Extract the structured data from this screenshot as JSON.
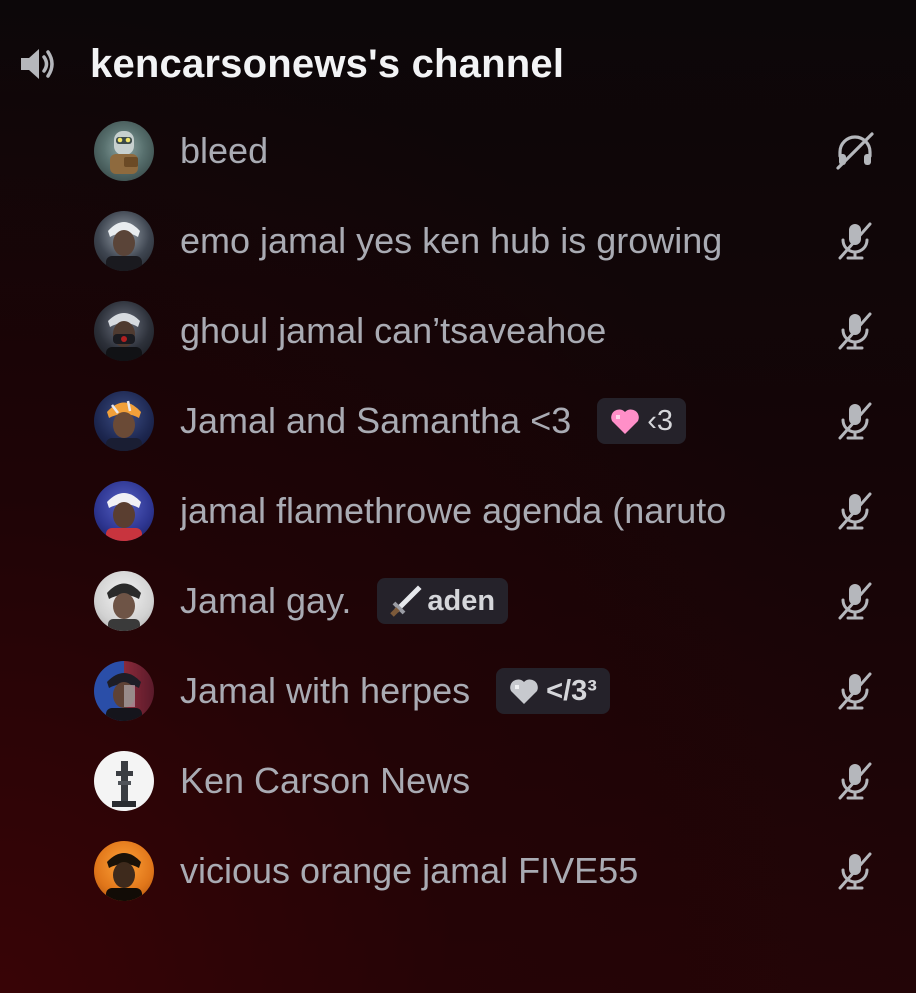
{
  "channel": {
    "name": "kencarsonews's channel",
    "icon": "speaker-icon"
  },
  "users": [
    {
      "name": "bleed",
      "avatar": "avatar-bleed",
      "status_icon": "deafened-icon"
    },
    {
      "name": "emo jamal yes ken hub is growing",
      "avatar": "avatar-emo-jamal",
      "status_icon": "muted-mic-icon"
    },
    {
      "name": "ghoul jamal can’tsaveahoe",
      "avatar": "avatar-ghoul-jamal",
      "status_icon": "muted-mic-icon"
    },
    {
      "name": "Jamal and Samantha <3",
      "avatar": "avatar-jamal-samantha",
      "status_icon": "muted-mic-icon",
      "tag": {
        "icon": "pink-heart-icon",
        "label": "‹3"
      }
    },
    {
      "name": "jamal flamethrowe agenda (naruto",
      "avatar": "avatar-jamal-flamethrowe",
      "status_icon": "muted-mic-icon"
    },
    {
      "name": "Jamal gay.",
      "avatar": "avatar-jamal-gay",
      "status_icon": "muted-mic-icon",
      "tag": {
        "icon": "sword-icon",
        "label": "aden"
      }
    },
    {
      "name": "Jamal with herpes",
      "avatar": "avatar-jamal-herpes",
      "status_icon": "muted-mic-icon",
      "tag": {
        "icon": "grey-heart-icon",
        "label": "</3³"
      }
    },
    {
      "name": "Ken Carson News",
      "avatar": "avatar-ken-carson-news",
      "status_icon": "muted-mic-icon"
    },
    {
      "name": "vicious orange jamal FIVE55",
      "avatar": "avatar-vicious-orange-jamal",
      "status_icon": "muted-mic-icon"
    }
  ],
  "colors": {
    "username": "#a9abb3",
    "channel_title": "#f2f3f5",
    "tag_background": "#25222a",
    "icon_grey": "#b5b7bc"
  }
}
